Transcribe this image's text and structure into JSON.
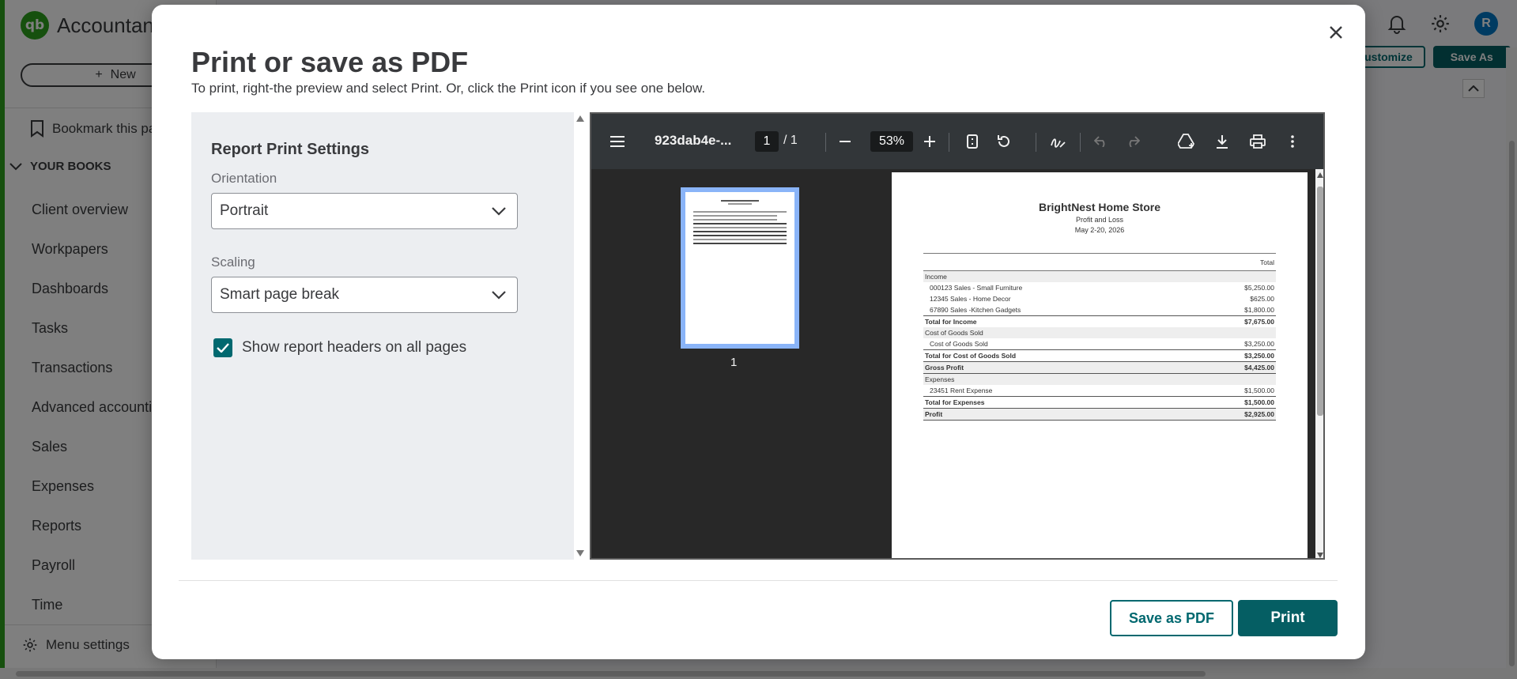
{
  "app": {
    "logo_text": "Accountant",
    "new_label": "New",
    "bookmark_label": "Bookmark this page",
    "section_label": "YOUR BOOKS",
    "nav_items": [
      "Client overview",
      "Workpapers",
      "Dashboards",
      "Tasks",
      "Transactions",
      "Advanced accounting",
      "Sales",
      "Expenses",
      "Reports",
      "Payroll",
      "Time"
    ],
    "menu_settings_label": "Menu settings",
    "avatar_initial": "R",
    "customize_label": "Customize",
    "save_as_label": "Save As"
  },
  "modal": {
    "title": "Print or save as PDF",
    "subtitle": "To print, right-the preview and select Print. Or, click the Print icon if you see one below.",
    "settings": {
      "title": "Report Print Settings",
      "orientation_label": "Orientation",
      "orientation_value": "Portrait",
      "scaling_label": "Scaling",
      "scaling_value": "Smart page break",
      "headers_checkbox_label": "Show report headers on all pages",
      "headers_checked": true
    },
    "viewer": {
      "filename": "923dab4e-...",
      "current_page": "1",
      "total_pages": "/  1",
      "zoom": "53%",
      "thumbnail_label": "1"
    },
    "report": {
      "company": "BrightNest Home Store",
      "report_name": "Profit and Loss",
      "date_range": "May 2-20, 2026",
      "total_header": "Total",
      "rows": [
        {
          "label": "Income",
          "value": "",
          "kind": "section"
        },
        {
          "label": "000123 Sales - Small Furniture",
          "value": "$5,250.00",
          "kind": "item"
        },
        {
          "label": "12345 Sales - Home Decor",
          "value": "$625.00",
          "kind": "item"
        },
        {
          "label": "67890 Sales -Kitchen Gadgets",
          "value": "$1,800.00",
          "kind": "item"
        },
        {
          "label": "Total for Income",
          "value": "$7,675.00",
          "kind": "total"
        },
        {
          "label": "Cost of Goods Sold",
          "value": "",
          "kind": "section"
        },
        {
          "label": "Cost of Goods Sold",
          "value": "$3,250.00",
          "kind": "item"
        },
        {
          "label": "Total for Cost of Goods Sold",
          "value": "$3,250.00",
          "kind": "total"
        },
        {
          "label": "Gross Profit",
          "value": "$4,425.00",
          "kind": "bold"
        },
        {
          "label": "Expenses",
          "value": "",
          "kind": "section"
        },
        {
          "label": "23451 Rent Expense",
          "value": "$1,500.00",
          "kind": "item"
        },
        {
          "label": "Total for Expenses",
          "value": "$1,500.00",
          "kind": "total"
        },
        {
          "label": "Profit",
          "value": "$2,925.00",
          "kind": "bold"
        }
      ]
    },
    "buttons": {
      "save_pdf": "Save as PDF",
      "print": "Print"
    }
  }
}
